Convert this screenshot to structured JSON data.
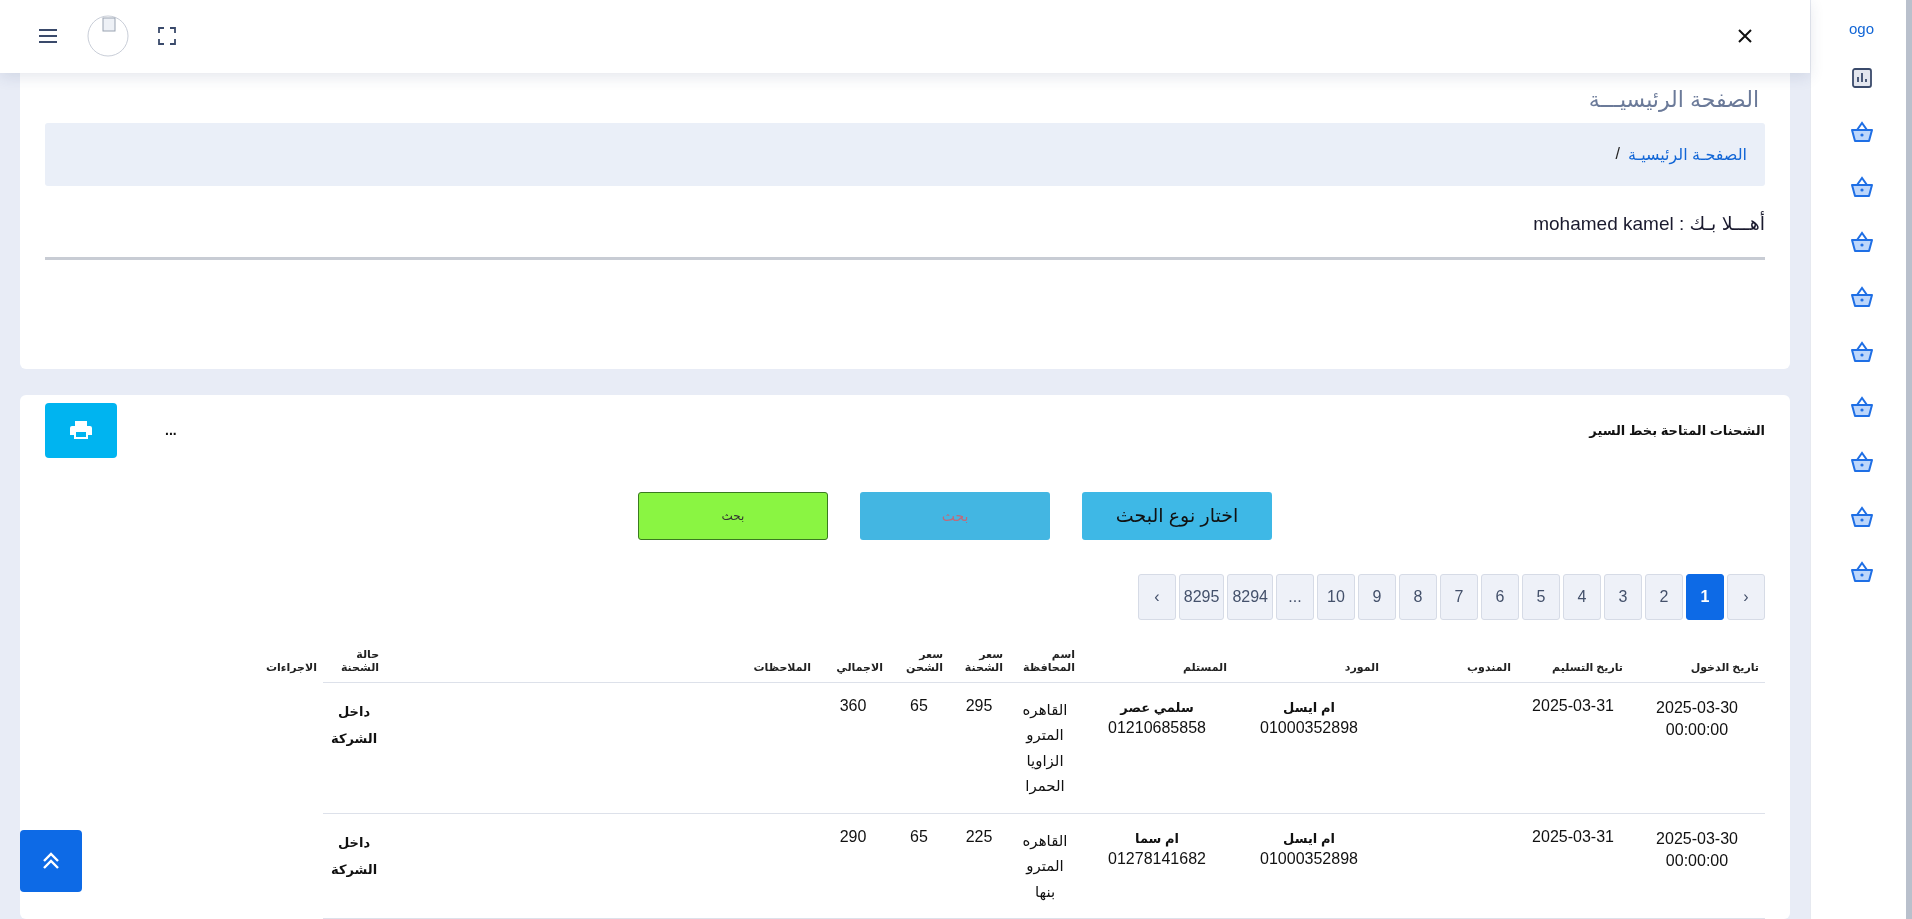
{
  "sidebar": {
    "logo_text": "ogo",
    "items": [
      {
        "kind": "chart"
      },
      {
        "kind": "basket"
      },
      {
        "kind": "basket"
      },
      {
        "kind": "basket"
      },
      {
        "kind": "basket"
      },
      {
        "kind": "basket"
      },
      {
        "kind": "basket"
      },
      {
        "kind": "basket"
      },
      {
        "kind": "basket"
      },
      {
        "kind": "basket"
      }
    ]
  },
  "page_title": "الصفحة الرئيسيـــة",
  "breadcrumb": {
    "link": "الصفحـة الرئيسيـة",
    "separator": "/"
  },
  "welcome": "أهـــلا بـك : mohamed kamel",
  "shipments": {
    "title": "الشحنات المتاحة بخط السير",
    "more": "...",
    "buttons": [
      {
        "label": "اختار نوع البحث",
        "kind": "choose"
      },
      {
        "label": "بحث",
        "kind": "disabled"
      },
      {
        "label": "بحث",
        "kind": "search"
      }
    ],
    "pagination": [
      {
        "label": "‹",
        "selected": false
      },
      {
        "label": "1",
        "selected": true
      },
      {
        "label": "2",
        "selected": false
      },
      {
        "label": "3",
        "selected": false
      },
      {
        "label": "4",
        "selected": false
      },
      {
        "label": "5",
        "selected": false
      },
      {
        "label": "6",
        "selected": false
      },
      {
        "label": "7",
        "selected": false
      },
      {
        "label": "8",
        "selected": false
      },
      {
        "label": "9",
        "selected": false
      },
      {
        "label": "10",
        "selected": false
      },
      {
        "label": "...",
        "selected": false
      },
      {
        "label": "8294",
        "selected": false
      },
      {
        "label": "8295",
        "selected": false
      },
      {
        "label": "›",
        "selected": false
      }
    ],
    "columns": [
      "تاريخ الدخول",
      "تاريخ التسليم",
      "المندوب",
      "المورد",
      "المستلم",
      "اسم المحافظة",
      "سعر الشحنة",
      "سعر الشحن",
      "الاجمالي",
      "الملاحظات",
      "حالة الشحنة",
      "الاجراءات"
    ],
    "rows": [
      {
        "entry_date": "2025-03-30 00:00:00",
        "delivery_date": "2025-03-31",
        "supplier": {
          "name": "ام ايسل",
          "phone": "01000352898"
        },
        "recipient": {
          "name": "سلمي عصر",
          "phone": "01210685858"
        },
        "governorate": "القاهره المترو الزاويا الحمرا",
        "price": "295",
        "shipping": "65",
        "total": "360",
        "status": "داخل الشركة"
      },
      {
        "entry_date": "2025-03-30 00:00:00",
        "delivery_date": "2025-03-31",
        "supplier": {
          "name": "ام ايسل",
          "phone": "01000352898"
        },
        "recipient": {
          "name": "ام سما",
          "phone": "01278141682"
        },
        "governorate": "القاهره المترو بنها",
        "price": "225",
        "shipping": "65",
        "total": "290",
        "status": "داخل الشركة"
      }
    ]
  }
}
